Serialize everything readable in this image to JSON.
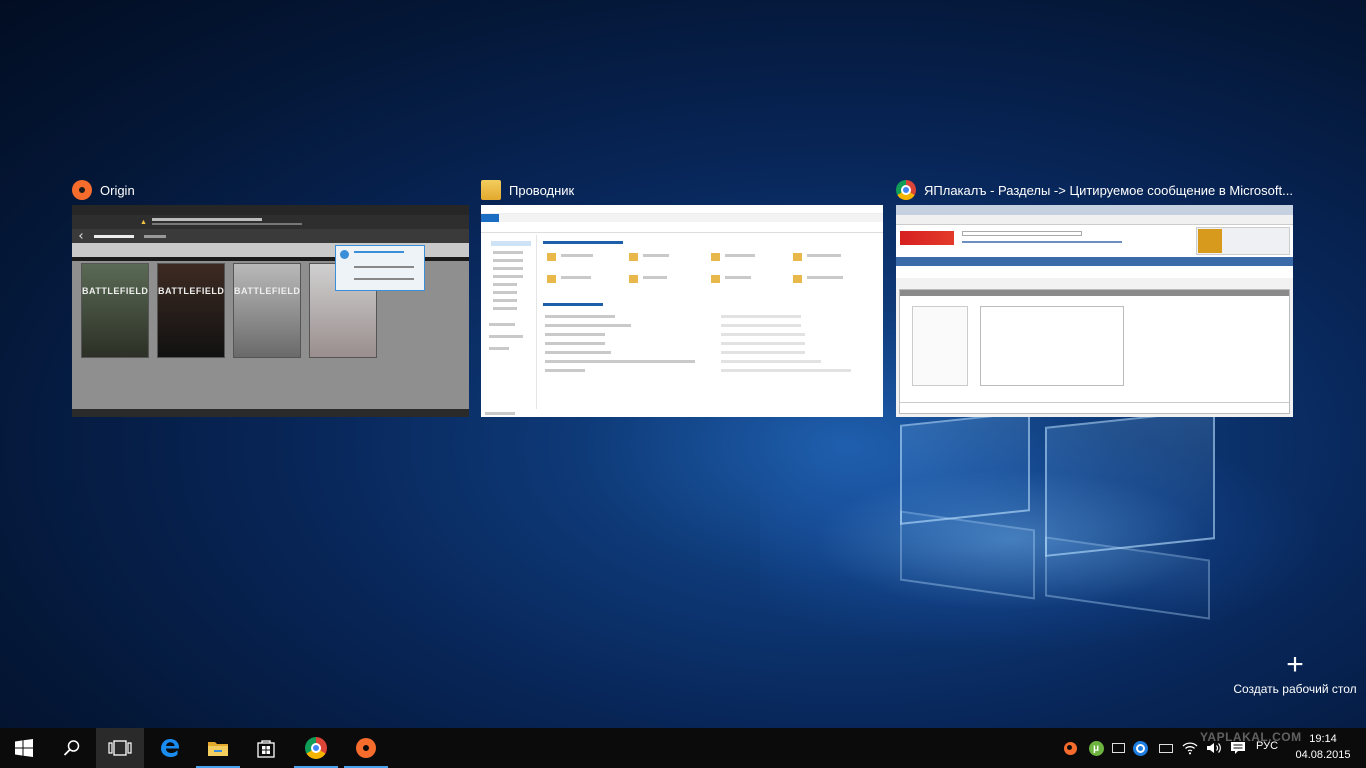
{
  "task_view": {
    "windows": [
      {
        "title": "Origin",
        "icon": "origin-icon",
        "games": [
          "BATTLEFIELD",
          "BATTLEFIELD",
          "BATTLEFIELD",
          ""
        ]
      },
      {
        "title": "Проводник",
        "icon": "file-explorer-icon"
      },
      {
        "title": "ЯПлакалъ - Разделы -> Цитируемое сообщение в Microsoft...",
        "icon": "chrome-icon"
      }
    ],
    "new_desktop": {
      "plus": "+",
      "label": "Создать рабочий стол"
    }
  },
  "taskbar": {
    "pinned": [
      "windows-start-icon",
      "search-icon",
      "task-view-icon",
      "edge-icon",
      "file-explorer-icon",
      "store-icon",
      "chrome-icon",
      "origin-icon"
    ],
    "tray": {
      "language": "РУС",
      "time": "19:14",
      "date": "04.08.2015"
    }
  },
  "watermark": "YAPLAKAL.COM",
  "colors": {
    "origin": "#f56c2d",
    "accent": "#4aa3ef",
    "chrome_red": "#db4437",
    "chrome_green": "#0f9d58",
    "chrome_yellow": "#f4b400",
    "chrome_blue": "#4285f4"
  }
}
